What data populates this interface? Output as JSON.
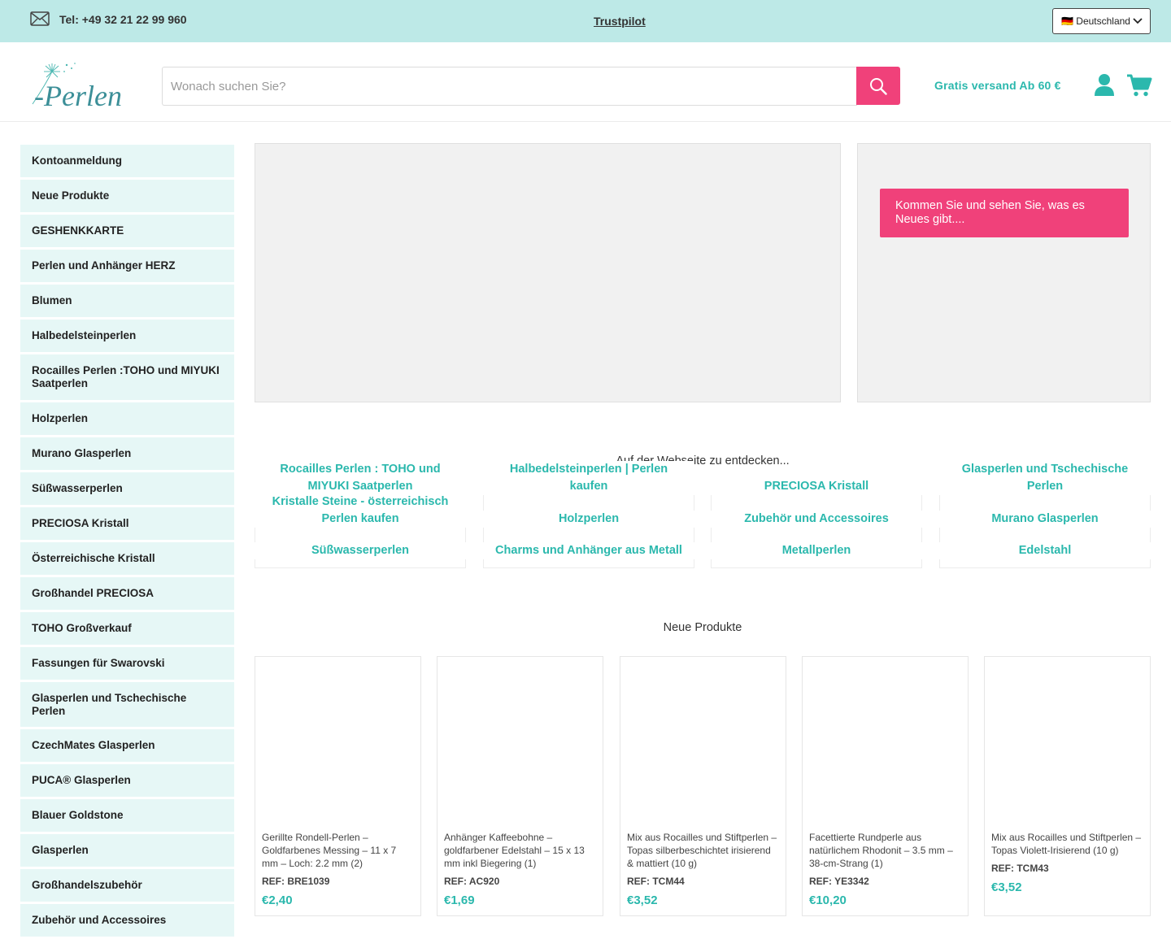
{
  "topbar": {
    "phone": "Tel: +49 32 21 22 99 960",
    "trustpilot": "Trustpilot",
    "language": "🇩🇪 Deutschland"
  },
  "header": {
    "logo_text": "-Perlen",
    "search_placeholder": "Wonach suchen Sie?",
    "shipping": "Gratis versand Ab 60 €"
  },
  "colors": {
    "topbar_bg": "#bde9e7",
    "accent_pink": "#f0417a",
    "accent_teal": "#2bb8ad",
    "sidebar_bg": "#e6f7f6"
  },
  "icons": [
    "mail-icon",
    "chevron-down-icon",
    "search-icon",
    "user-icon",
    "cart-icon"
  ],
  "sidebar": {
    "items": [
      "Kontoanmeldung",
      "Neue Produkte",
      "GESHENKKARTE",
      "Perlen und Anhänger HERZ",
      "Blumen",
      "Halbedelsteinperlen",
      "Rocailles Perlen :TOHO und MIYUKI Saatperlen",
      "Holzperlen",
      "Murano Glasperlen",
      "Süßwasserperlen",
      "PRECIOSA Kristall",
      "Österreichische Kristall",
      "Großhandel PRECIOSA",
      "TOHO Großverkauf",
      "Fassungen für Swarovski",
      "Glasperlen und Tschechische Perlen",
      "CzechMates Glasperlen",
      "PUCA® Glasperlen",
      "Blauer Goldstone",
      "Glasperlen",
      "Großhandelszubehör",
      "Zubehör und Accessoires"
    ]
  },
  "hero": {
    "promo": "Kommen Sie und sehen Sie, was es Neues gibt...."
  },
  "discover": {
    "title": "Auf der Webseite zu entdecken...",
    "columns": [
      [
        "Rocailles Perlen : TOHO und MIYUKI Saatperlen",
        "Kristalle Steine - österreichisch Perlen kaufen",
        "Süßwasserperlen"
      ],
      [
        "Halbedelsteinperlen | Perlen kaufen",
        "Holzperlen",
        "Charms und Anhänger aus Metall"
      ],
      [
        "PRECIOSA Kristall",
        "Zubehör und Accessoires",
        "Metallperlen"
      ],
      [
        "Glasperlen und Tschechische Perlen",
        "Murano Glasperlen",
        "Edelstahl"
      ]
    ]
  },
  "new_products": {
    "title": "Neue Produkte",
    "items": [
      {
        "name": "Gerillte Rondell-Perlen – Goldfarbenes Messing – 11 x 7 mm – Loch: 2.2 mm (2)",
        "ref": "REF: BRE1039",
        "price": "€2,40"
      },
      {
        "name": "Anhänger Kaffeebohne – goldfarbener Edelstahl – 15 x 13 mm inkl Biegering (1)",
        "ref": "REF: AC920",
        "price": "€1,69"
      },
      {
        "name": "Mix aus Rocailles und Stiftperlen – Topas silberbeschichtet irisierend & mattiert (10 g)",
        "ref": "REF: TCM44",
        "price": "€3,52"
      },
      {
        "name": "Facettierte Rundperle aus natürlichem Rhodonit – 3.5 mm – 38-cm-Strang (1)",
        "ref": "REF: YE3342",
        "price": "€10,20"
      },
      {
        "name": "Mix aus Rocailles und Stiftperlen – Topas Violett-Irisierend (10 g)",
        "ref": "REF: TCM43",
        "price": "€3,52"
      }
    ]
  }
}
